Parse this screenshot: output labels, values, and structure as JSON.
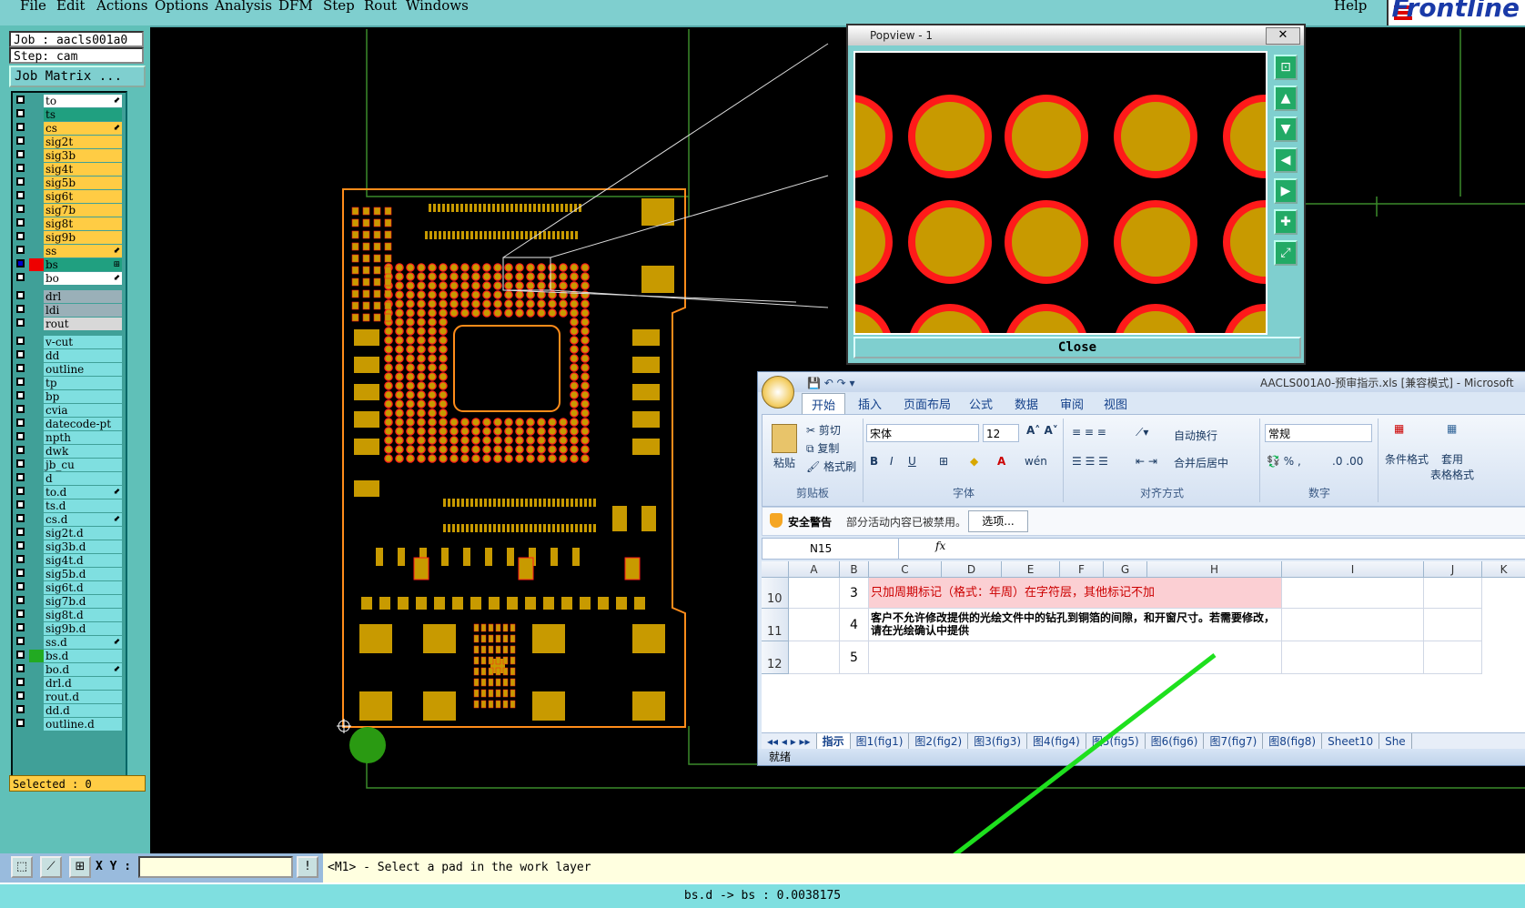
{
  "menu": {
    "items": [
      "File",
      "Edit",
      "Actions",
      "Options",
      "Analysis",
      "DFM",
      "Step",
      "Rout",
      "Windows"
    ],
    "help": "Help",
    "logo": "Frontline"
  },
  "job": {
    "job_label": "Job : aacls001a0",
    "step_label": "Step: cam",
    "matrix_button": "Job Matrix ..."
  },
  "layers": [
    {
      "name": "to",
      "color": "#ffffff",
      "arrow": "⬋"
    },
    {
      "name": "ts",
      "color": "#20a080",
      "arrow": ""
    },
    {
      "name": "cs",
      "color": "#ffcc44",
      "arrow": "⬋"
    },
    {
      "name": "sig2t",
      "color": "#ffcc44",
      "arrow": ""
    },
    {
      "name": "sig3b",
      "color": "#ffcc44",
      "arrow": ""
    },
    {
      "name": "sig4t",
      "color": "#ffcc44",
      "arrow": ""
    },
    {
      "name": "sig5b",
      "color": "#ffcc44",
      "arrow": ""
    },
    {
      "name": "sig6t",
      "color": "#ffcc44",
      "arrow": ""
    },
    {
      "name": "sig7b",
      "color": "#ffcc44",
      "arrow": ""
    },
    {
      "name": "sig8t",
      "color": "#ffcc44",
      "arrow": ""
    },
    {
      "name": "sig9b",
      "color": "#ffcc44",
      "arrow": ""
    },
    {
      "name": "ss",
      "color": "#ffcc44",
      "arrow": "⬋"
    },
    {
      "name": "bs",
      "color": "#20a080",
      "arrow": "⊞"
    },
    {
      "name": "bo",
      "color": "#ffffff",
      "arrow": "⬋"
    },
    {
      "name": "drl",
      "color": "#9ab0b8",
      "arrow": ""
    },
    {
      "name": "ldi",
      "color": "#9ab0b8",
      "arrow": ""
    },
    {
      "name": "rout",
      "color": "#d8d8d8",
      "arrow": ""
    },
    {
      "name": "v-cut",
      "color": "#7fdfe0",
      "arrow": ""
    },
    {
      "name": "dd",
      "color": "#7fdfe0",
      "arrow": ""
    },
    {
      "name": "outline",
      "color": "#7fdfe0",
      "arrow": ""
    },
    {
      "name": "tp",
      "color": "#7fdfe0",
      "arrow": ""
    },
    {
      "name": "bp",
      "color": "#7fdfe0",
      "arrow": ""
    },
    {
      "name": "cvia",
      "color": "#7fdfe0",
      "arrow": ""
    },
    {
      "name": "datecode-pt",
      "color": "#7fdfe0",
      "arrow": ""
    },
    {
      "name": "npth",
      "color": "#7fdfe0",
      "arrow": ""
    },
    {
      "name": "dwk",
      "color": "#7fdfe0",
      "arrow": ""
    },
    {
      "name": "jb_cu",
      "color": "#7fdfe0",
      "arrow": ""
    },
    {
      "name": "d",
      "color": "#7fdfe0",
      "arrow": ""
    },
    {
      "name": "to.d",
      "color": "#7fdfe0",
      "arrow": "⬋"
    },
    {
      "name": "ts.d",
      "color": "#7fdfe0",
      "arrow": ""
    },
    {
      "name": "cs.d",
      "color": "#7fdfe0",
      "arrow": "⬋"
    },
    {
      "name": "sig2t.d",
      "color": "#7fdfe0",
      "arrow": ""
    },
    {
      "name": "sig3b.d",
      "color": "#7fdfe0",
      "arrow": ""
    },
    {
      "name": "sig4t.d",
      "color": "#7fdfe0",
      "arrow": ""
    },
    {
      "name": "sig5b.d",
      "color": "#7fdfe0",
      "arrow": ""
    },
    {
      "name": "sig6t.d",
      "color": "#7fdfe0",
      "arrow": ""
    },
    {
      "name": "sig7b.d",
      "color": "#7fdfe0",
      "arrow": ""
    },
    {
      "name": "sig8t.d",
      "color": "#7fdfe0",
      "arrow": ""
    },
    {
      "name": "sig9b.d",
      "color": "#7fdfe0",
      "arrow": ""
    },
    {
      "name": "ss.d",
      "color": "#7fdfe0",
      "arrow": "⬋"
    },
    {
      "name": "bs.d",
      "color": "#7fdfe0",
      "arrow": ""
    },
    {
      "name": "bo.d",
      "color": "#7fdfe0",
      "arrow": "⬋"
    },
    {
      "name": "drl.d",
      "color": "#7fdfe0",
      "arrow": ""
    },
    {
      "name": "rout.d",
      "color": "#7fdfe0",
      "arrow": ""
    },
    {
      "name": "dd.d",
      "color": "#7fdfe0",
      "arrow": ""
    },
    {
      "name": "outline.d",
      "color": "#7fdfe0",
      "arrow": ""
    }
  ],
  "selected_label": "Selected : 0",
  "cmd": {
    "xy_label": "X Y :",
    "xy_value": "",
    "prompt": "<M1> - Select a pad in the work layer"
  },
  "status": "bs.d -> bs : 0.0038175",
  "popview": {
    "title": "Popview - 1",
    "close_label": "Close",
    "x_label": "✕"
  },
  "excel": {
    "title": "AACLS001A0-预审指示.xls  [兼容模式] - Microsoft",
    "tabs": [
      "开始",
      "插入",
      "页面布局",
      "公式",
      "数据",
      "审阅",
      "视图"
    ],
    "ribbon": {
      "paste": "粘贴",
      "cut": "剪切",
      "copy": "复制",
      "format_painter": "格式刷",
      "clipboard": "剪贴板",
      "font_name": "宋体",
      "font_size": "12",
      "font_group": "字体",
      "wrap": "自动换行",
      "merge": "合并后居中",
      "align_group": "对齐方式",
      "number_format": "常规",
      "number_group": "数字",
      "cond_format": "条件格式",
      "table_format": "套用\n表格格式"
    },
    "security": {
      "label": "安全警告",
      "message": "部分活动内容已被禁用。",
      "options": "选项..."
    },
    "name_box": "N15",
    "fx": "fx",
    "columns": [
      "A",
      "B",
      "C",
      "D",
      "E",
      "F",
      "G",
      "H",
      "I",
      "J",
      "K"
    ],
    "rows": [
      {
        "num": "10",
        "b": "3",
        "text": "只加周期标记（格式：年周）在字符层，其他标记不加"
      },
      {
        "num": "11",
        "b": "4",
        "text": "客户不允许修改提供的光绘文件中的钻孔到铜箔的间隙，和开窗尺寸。若需要修改，请在光绘确认中提供"
      },
      {
        "num": "12",
        "b": "5",
        "text": ""
      }
    ],
    "sheets": [
      "指示",
      "图1(fig1)",
      "图2(fig2)",
      "图3(fig3)",
      "图4(fig4)",
      "图5(fig5)",
      "图6(fig6)",
      "图7(fig7)",
      "图8(fig8)",
      "Sheet10",
      "She"
    ],
    "status": "就绪"
  },
  "colors": {
    "pad": "#c89a00",
    "pad_ring": "#ff1a1a",
    "board_outline": "#ff8c1a",
    "grid_line": "#3a8a2a",
    "arrow": "#1ee01e"
  }
}
